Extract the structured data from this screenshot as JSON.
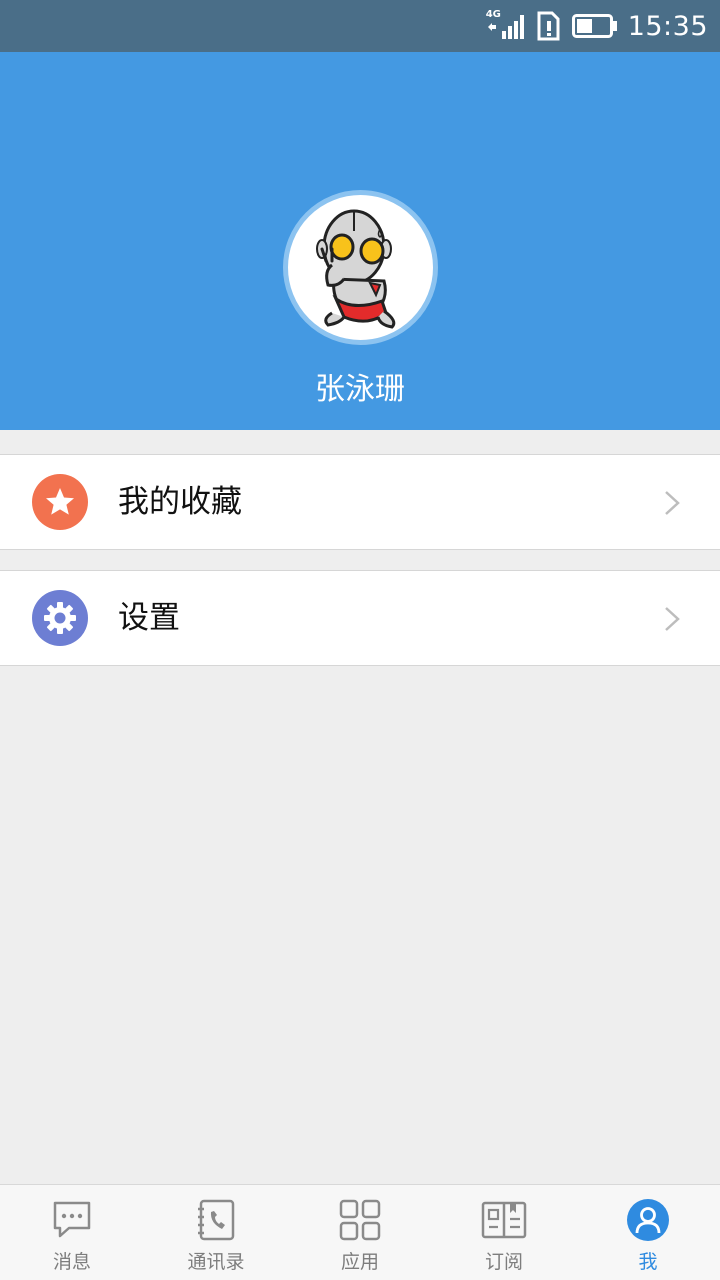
{
  "status_bar": {
    "network": "4G",
    "time": "15:35"
  },
  "profile": {
    "name": "张泳珊",
    "avatar": "ultraman-cartoon-avatar"
  },
  "menu": {
    "favorites_label": "我的收藏",
    "favorites_icon": "star-icon",
    "settings_label": "设置",
    "settings_icon": "gear-icon"
  },
  "bottom_nav": {
    "items": [
      {
        "label": "消息",
        "icon": "chat-bubble-icon"
      },
      {
        "label": "通讯录",
        "icon": "contacts-phone-icon"
      },
      {
        "label": "应用",
        "icon": "apps-grid-icon"
      },
      {
        "label": "订阅",
        "icon": "subscription-icon"
      },
      {
        "label": "我",
        "icon": "person-icon"
      }
    ],
    "active_index": 4
  },
  "colors": {
    "header_blue": "#4499e2",
    "favorites_orange": "#f2724f",
    "settings_indigo": "#6d7ed3",
    "active_nav": "#2f8be0"
  }
}
